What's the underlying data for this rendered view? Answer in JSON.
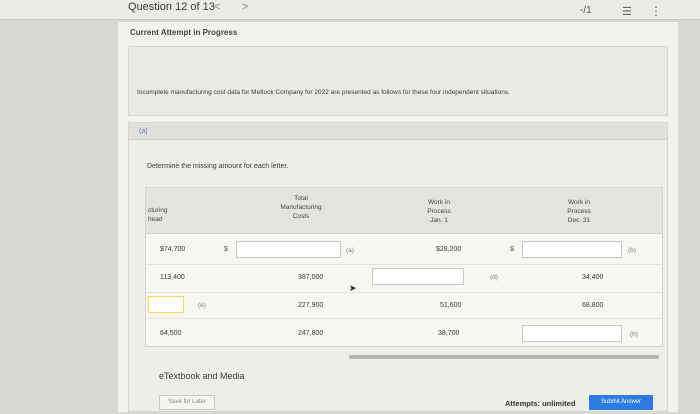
{
  "topbar": {
    "question_label": "Question 12 of 13",
    "prev_glyph": "<",
    "next_glyph": ">",
    "score": "-/1",
    "list_icon_glyph": "☰",
    "more_icon_glyph": "⋮"
  },
  "status": "Current Attempt in Progress",
  "intro": "Incomplete manufacturing cost data for Metlock Company for 2022 are presented as follows for these four independent situations.",
  "part_label": "(a)",
  "instruction": "Determine the missing amount for each letter.",
  "table": {
    "headers": {
      "col1": "cturing\nhead",
      "col2": "Total\nManufacturing\nCosts",
      "col3": "Work in\nProcess\nJan. 1",
      "col4": "Work in\nProcess\nDec. 31"
    },
    "rows": [
      {
        "c1": "$74,700",
        "dollar2": "$",
        "c2": "",
        "letter2": "(a)",
        "c3": "$28,200",
        "dollar4": "$",
        "c4": "",
        "letter4": "(b)"
      },
      {
        "c1": "113,400",
        "c2": "387,000",
        "c3": "",
        "letter3": "(d)",
        "c4": "34,400"
      },
      {
        "c1": "",
        "letter1": "(e)",
        "c2": "227,900",
        "c3": "51,600",
        "c4": "68,800"
      },
      {
        "c1": "64,500",
        "c2": "247,800",
        "c3": "38,700",
        "c4": "",
        "letter4": "(h)"
      }
    ]
  },
  "etextbook": "eTextbook and Media",
  "save_label": "Save for Later",
  "attempts": "Attempts: unlimited",
  "submit_label": "Submit Answer",
  "colors": {
    "submit": "#2b7be0",
    "highlight": "#ffd35c"
  }
}
